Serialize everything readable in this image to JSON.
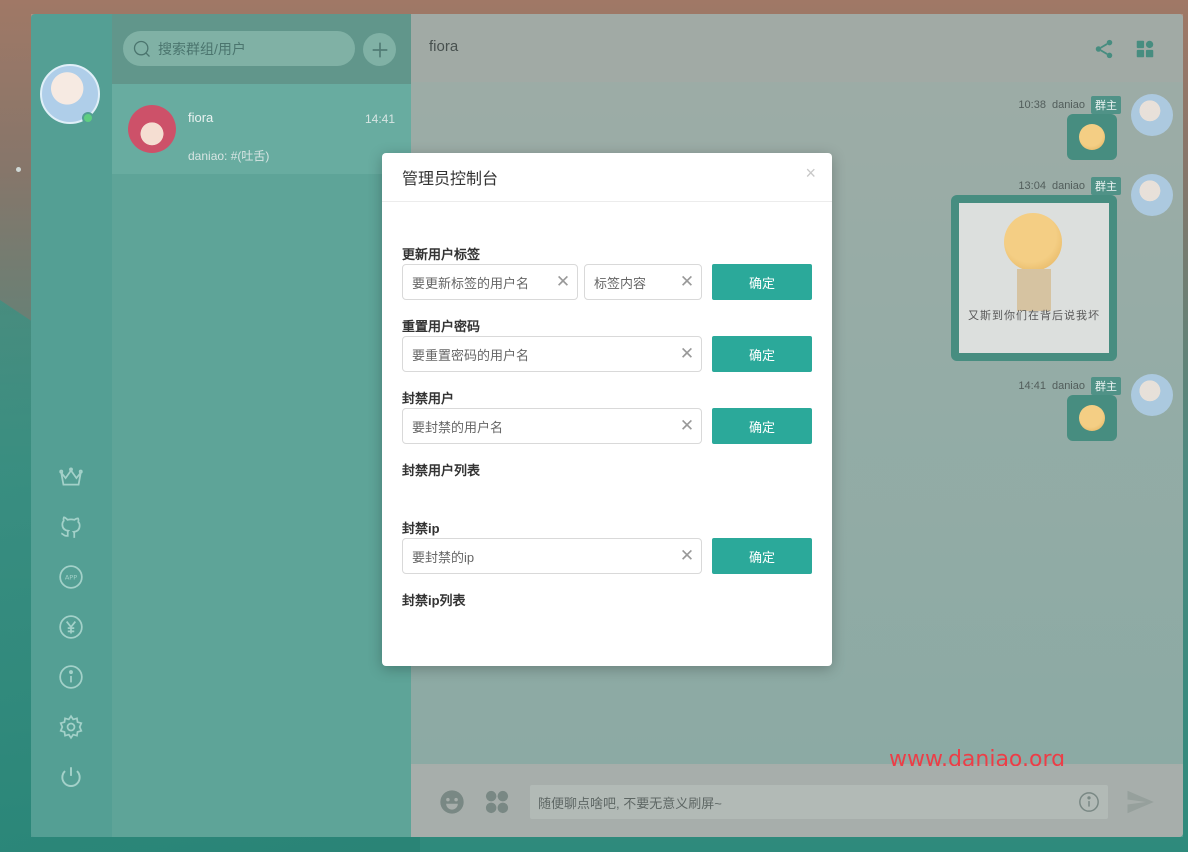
{
  "search": {
    "placeholder": "搜索群组/用户"
  },
  "conversation": {
    "name": "fiora",
    "time": "14:41",
    "preview": "daniao: #(吐舌)"
  },
  "chat": {
    "title": "fiora",
    "messages": [
      {
        "time": "10:38",
        "author": "daniao",
        "badge": "群主"
      },
      {
        "time": "13:04",
        "author": "daniao",
        "badge": "群主",
        "image_caption": "又斯到你们在背后说我坏"
      },
      {
        "time": "14:41",
        "author": "daniao",
        "badge": "群主"
      }
    ],
    "composer_placeholder": "随便聊点啥吧, 不要无意义刷屏~"
  },
  "watermark": "www.daniao.org",
  "modal": {
    "title": "管理员控制台",
    "close": "×",
    "update_tag": {
      "label": "更新用户标签",
      "username_placeholder": "要更新标签的用户名",
      "tag_placeholder": "标签内容",
      "button": "确定"
    },
    "reset_password": {
      "label": "重置用户密码",
      "placeholder": "要重置密码的用户名",
      "button": "确定"
    },
    "ban_user": {
      "label": "封禁用户",
      "placeholder": "要封禁的用户名",
      "button": "确定"
    },
    "banned_user_list": {
      "label": "封禁用户列表"
    },
    "ban_ip": {
      "label": "封禁ip",
      "placeholder": "要封禁的ip",
      "button": "确定"
    },
    "banned_ip_list": {
      "label": "封禁ip列表"
    }
  },
  "colors": {
    "accent": "#2ba99a",
    "nav": "#2f8a7d",
    "bubble": "#1f7565",
    "watermark": "#e8141f"
  },
  "icons": {
    "nav": [
      "crown-icon",
      "github-icon",
      "app-icon",
      "yen-icon",
      "info-icon",
      "gear-icon",
      "power-icon"
    ],
    "header": [
      "share-icon",
      "apps-icon"
    ],
    "composer": [
      "emoji-icon",
      "function-icon",
      "info-icon",
      "send-icon"
    ]
  }
}
